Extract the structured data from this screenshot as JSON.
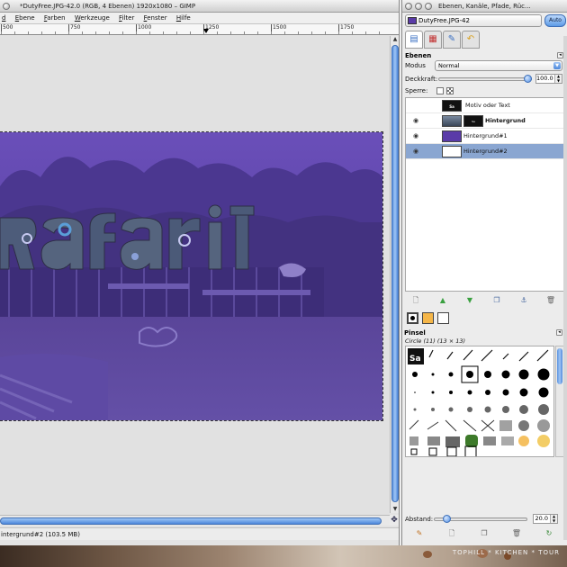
{
  "image_window": {
    "title": "*DutyFree.JPG-42.0 (RGB, 4 Ebenen) 1920x1080 – GIMP",
    "menu": [
      "d",
      "Ebene",
      "Farben",
      "Werkzeuge",
      "Filter",
      "Fenster",
      "Hilfe"
    ],
    "ruler_labels": [
      "500",
      "750",
      "1000",
      "1250",
      "1500",
      "1750"
    ],
    "status": "intergrund#2 (103.5 MB)"
  },
  "dock": {
    "title": "Ebenen, Kanäle, Pfade, Rüc...",
    "image_selector": "DutyFree.JPG-42",
    "auto_label": "Auto",
    "layers_panel": {
      "header": "Ebenen",
      "mode_label": "Modus",
      "mode_value": "Normal",
      "opacity_label": "Deckkraft:",
      "opacity_value": "100.0",
      "opacity_fraction": 1.0,
      "lock_label": "Sperre:",
      "layers": [
        {
          "name": "Motiv oder Text",
          "visible": false,
          "bold": false,
          "selected": false,
          "thumb": "#111111"
        },
        {
          "name": "Hintergrund",
          "visible": true,
          "bold": true,
          "selected": false,
          "thumb": "#4a5a66"
        },
        {
          "name": "Hintergrund#1",
          "visible": true,
          "bold": false,
          "selected": false,
          "thumb": "#5a3ba8"
        },
        {
          "name": "Hintergrund#2",
          "visible": true,
          "bold": false,
          "selected": true,
          "thumb": "#ffffff"
        }
      ]
    },
    "brushes_panel": {
      "header": "Pinsel",
      "current": "Circle (11) (13 × 13)",
      "spacing_label": "Abstand:",
      "spacing_value": "20.0"
    },
    "colors": {
      "fg": "#000000",
      "bg": "#ffffff",
      "tool": "#f5b648"
    }
  },
  "watermark": "TOPHILL * KITCHEN * TOUR",
  "accent": "#5a3ba8"
}
